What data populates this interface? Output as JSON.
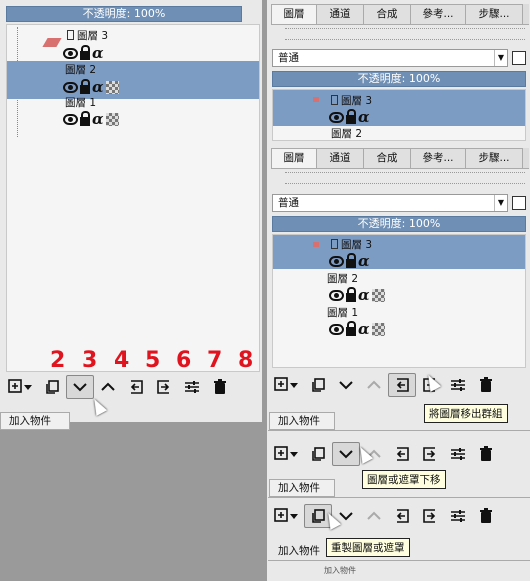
{
  "left": {
    "opacity": "不透明度: 100%",
    "layers": [
      "圖層 3",
      "圖層 2",
      "圖層 1"
    ],
    "numbers": [
      "2",
      "3",
      "4",
      "5",
      "6",
      "7",
      "8"
    ],
    "add_tab": "加入物件"
  },
  "right1": {
    "tabs": [
      "圖層",
      "通道",
      "合成",
      "參考...",
      "步驟..."
    ],
    "blend": "普通",
    "opacity": "不透明度: 100%",
    "layers": [
      "圖層 3",
      "圖層 2"
    ]
  },
  "right2": {
    "tabs": [
      "圖層",
      "通道",
      "合成",
      "參考...",
      "步驟..."
    ],
    "blend": "普通",
    "opacity": "不透明度: 100%",
    "layers": [
      "圖層 3",
      "圖層 2",
      "圖層 1"
    ],
    "tooltip": "將圖層移出群組"
  },
  "right3": {
    "add_tab": "加入物件",
    "tooltip": "圖層或遮罩下移"
  },
  "right4": {
    "add_tab": "加入物件",
    "tooltip": "重製圖層或遮罩",
    "bottom_label": "加入物件",
    "bottom_sub": "加入物件"
  },
  "icons": [
    "layer-page-icon",
    "eye-icon",
    "lock-icon",
    "alpha-icon",
    "checker-icon",
    "add-layer-icon",
    "duplicate-icon",
    "move-down-icon",
    "move-up-icon",
    "ungroup-icon",
    "group-icon",
    "properties-icon",
    "delete-icon",
    "cursor-icon"
  ],
  "colors": {
    "selection": "#7d9cc4",
    "opacity_bar": "#6f8fb5",
    "numbers": "#e0141e",
    "tooltip_bg": "#ffffe0"
  }
}
